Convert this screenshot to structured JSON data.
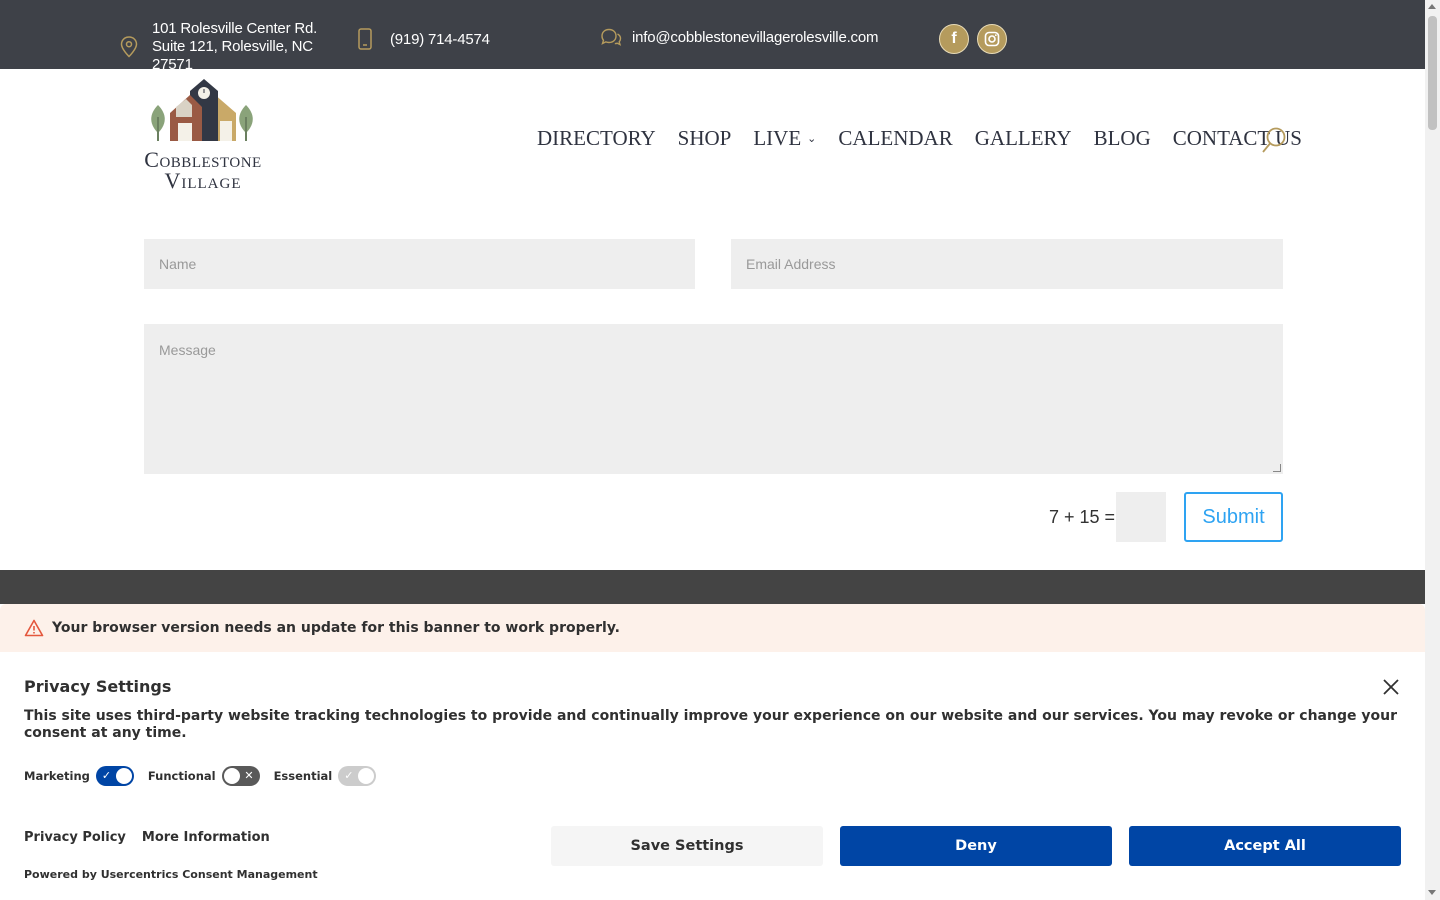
{
  "topbar": {
    "address": "101 Rolesville Center Rd. Suite 121, Rolesville, NC 27571",
    "phone": "(919) 714-4574",
    "email": "info@cobblestonevillagerolesville.com",
    "social": {
      "facebook": "f",
      "instagram": "instagram-icon"
    }
  },
  "logo": {
    "line1": "Cobblestone",
    "line2": "Village"
  },
  "nav": {
    "items": [
      {
        "label": "DIRECTORY"
      },
      {
        "label": "SHOP"
      },
      {
        "label": "LIVE",
        "has_submenu": true
      },
      {
        "label": "CALENDAR"
      },
      {
        "label": "GALLERY"
      },
      {
        "label": "BLOG"
      },
      {
        "label": "CONTACT US"
      }
    ],
    "search_icon": "search-icon"
  },
  "form": {
    "name_placeholder": "Name",
    "email_placeholder": "Email Address",
    "message_placeholder": "Message",
    "captcha": "7 + 15 =",
    "submit_label": "Submit"
  },
  "banner": {
    "warning": "Your browser version needs an update for this banner to work properly.",
    "title": "Privacy Settings",
    "description": "This site uses third-party website tracking technologies to provide and continually improve your experience on our website and our services. You may revoke or change your consent at any time.",
    "toggles": [
      {
        "label": "Marketing",
        "state": "on"
      },
      {
        "label": "Functional",
        "state": "off"
      },
      {
        "label": "Essential",
        "state": "disabled-on"
      }
    ],
    "links": {
      "privacy_policy": "Privacy Policy",
      "more_info": "More Information"
    },
    "powered_by": "Powered by Usercentrics Consent Management",
    "buttons": {
      "save": "Save Settings",
      "deny": "Deny",
      "accept": "Accept All"
    }
  },
  "colors": {
    "topbar": "#3e4148",
    "gold": "#b59b5d",
    "link_blue": "#2ea3f2",
    "consent_blue": "#0045a5",
    "warning_bg": "#fdf1ea"
  }
}
